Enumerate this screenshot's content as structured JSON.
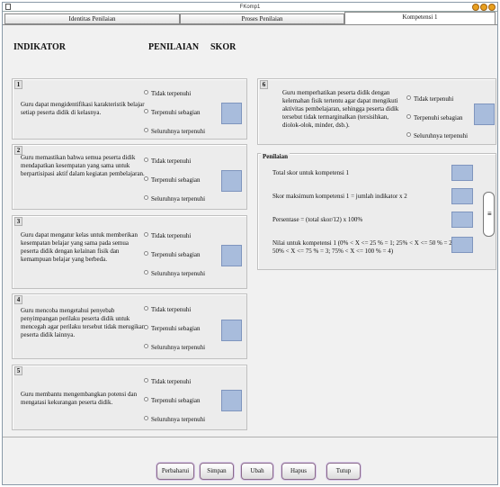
{
  "window": {
    "title": "FKomp1"
  },
  "tabs": [
    {
      "label": "Identitas Penilaian"
    },
    {
      "label": "Proses Penilaian"
    },
    {
      "label": "Kompetensi 1"
    }
  ],
  "headers": {
    "indikator": "INDIKATOR",
    "penilaian": "PENILAIAN",
    "skor": "SKOR"
  },
  "options": [
    "Tidak terpenuhi",
    "Terpenuhi sebagian",
    "Seluruhnya terpenuhi"
  ],
  "indicators": [
    {
      "num": "1",
      "text": "Guru dapat mengidentifikasi karakteristik belajar setiap peserta didik di kelasnya."
    },
    {
      "num": "2",
      "text": "Guru memastikan bahwa semua peserta didik mendapatkan kesempatan yang sama untuk berpartisipasi aktif dalam kegiatan pembelajaran."
    },
    {
      "num": "3",
      "text": "Guru dapat mengatur kelas untuk memberikan kesempatan belajar yang sama pada semua peserta didik dengan kelainan fisik dan kemampuan belajar yang berbeda."
    },
    {
      "num": "4",
      "text": "Guru mencoba mengetahui penyebab penyimpangan perilaku peserta didik untuk mencegah agar perilaku tersebut tidak merugikan peserta didik lainnya."
    },
    {
      "num": "5",
      "text": "Guru membantu mengembangkan potensi dan mengatasi kekurangan peserta didik."
    },
    {
      "num": "6",
      "text": "Guru memperhatikan peserta didik dengan kelemahan fisik tertentu agar dapat mengikuti aktivitas pembelajaran, sehingga peserta didik tersebut tidak termarginalkan (tersisihkan, diolok-olok, minder, dsb.)."
    }
  ],
  "penilaian": {
    "title": "Penilaian",
    "total": "Total skor untuk kompetensi 1",
    "max": "Skor maksimum kompetensi 1 = jumlah indikator x 2",
    "persen": "Persentase = (total skor/12) x 100%",
    "nilai": "Nilai untuk kompetensi 1  (0% < X <= 25 % = 1; 25% < X <= 50 % = 2; 50% < X <= 75 % = 3; 75% < X <= 100 % = 4)"
  },
  "buttons": [
    "Perbaharui",
    "Simpan",
    "Ubah",
    "Hapus",
    "Tutup"
  ]
}
